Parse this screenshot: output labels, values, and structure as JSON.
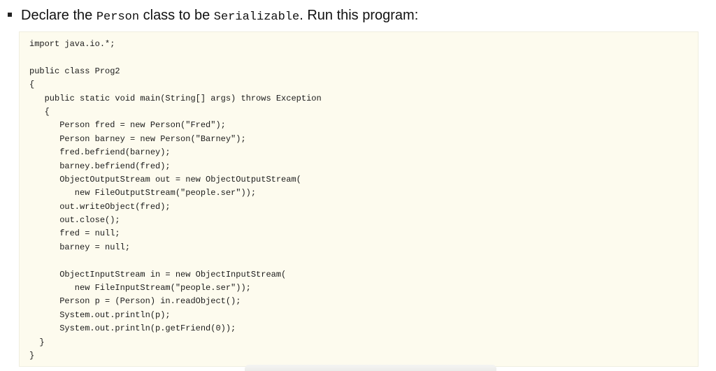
{
  "instruction": {
    "prefix": "Declare the ",
    "class_name": "Person",
    "middle": " class to be ",
    "interface_name": "Serializable",
    "suffix": ". Run this program:"
  },
  "code_lines": [
    "import java.io.*;",
    "",
    "public class Prog2",
    "{",
    "   public static void main(String[] args) throws Exception",
    "   {",
    "      Person fred = new Person(\"Fred\");",
    "      Person barney = new Person(\"Barney\");",
    "      fred.befriend(barney);",
    "      barney.befriend(fred);",
    "      ObjectOutputStream out = new ObjectOutputStream(",
    "         new FileOutputStream(\"people.ser\"));",
    "      out.writeObject(fred);",
    "      out.close();",
    "      fred = null;",
    "      barney = null;",
    "",
    "      ObjectInputStream in = new ObjectInputStream(",
    "         new FileInputStream(\"people.ser\"));",
    "      Person p = (Person) in.readObject();",
    "      System.out.println(p);",
    "      System.out.println(p.getFriend(0));",
    "  }",
    "}"
  ]
}
